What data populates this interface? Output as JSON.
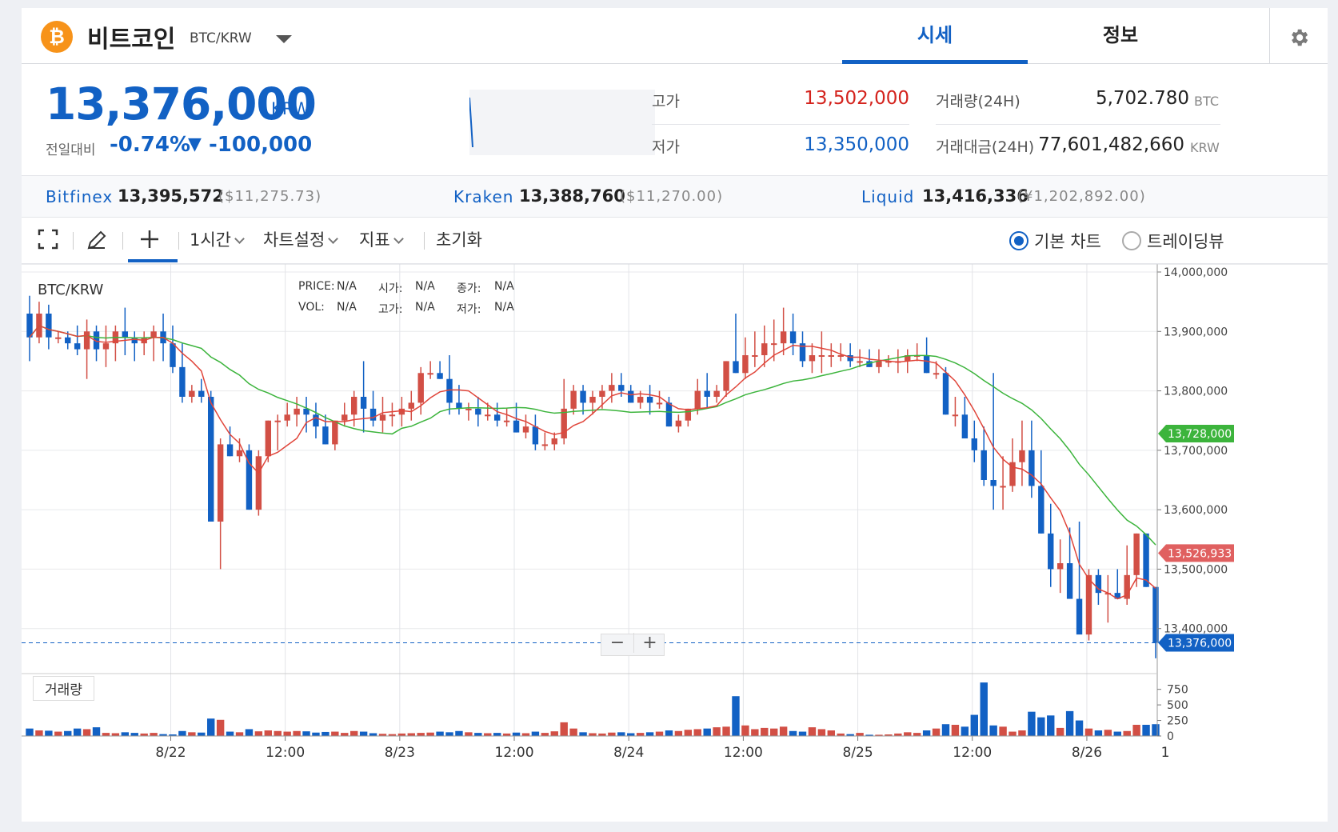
{
  "header": {
    "coin_symbol": "₿",
    "coin_name": "비트코인",
    "pair": "BTC/KRW",
    "tabs": [
      {
        "label": "시세",
        "active": true
      },
      {
        "label": "정보",
        "active": false
      }
    ]
  },
  "summary": {
    "price": "13,376,000",
    "unit": "KRW",
    "change_label": "전일대비",
    "change_rate": "-0.74%",
    "change_arrow": "▼",
    "change_amount": "-100,000",
    "high_label": "고가",
    "high_value": "13,502,000",
    "low_label": "저가",
    "low_value": "13,350,000",
    "volume_label": "거래량(24H)",
    "volume_value": "5,702.780",
    "volume_unit": "BTC",
    "amount_label": "거래대금(24H)",
    "amount_value": "77,601,482,660",
    "amount_unit": "KRW"
  },
  "exchanges": [
    {
      "name": "Bitfinex",
      "price": "13,395,572",
      "alt": "($11,275.73)"
    },
    {
      "name": "Kraken",
      "price": "13,388,760",
      "alt": "($11,270.00)"
    },
    {
      "name": "Liquid",
      "price": "13,416,336",
      "alt": "(¥1,202,892.00)"
    }
  ],
  "toolbar": {
    "interval": "1시간",
    "chart_settings": "차트설정",
    "indicators": "지표",
    "reset": "초기화",
    "basic_chart": "기본 차트",
    "tradingview": "트레이딩뷰"
  },
  "chart_overlay": {
    "symbol": "BTC/KRW",
    "price_label": "PRICE:",
    "price_val": "N/A",
    "open_label": "시가:",
    "open_val": "N/A",
    "close_label": "종가:",
    "close_val": "N/A",
    "vol_label": "VOL:",
    "vol_val": "N/A",
    "high_label": "고가:",
    "high_val": "N/A",
    "low_label": "저가:",
    "low_val": "N/A",
    "volume_pane_label": "거래량",
    "zoom_out": "−",
    "zoom_in": "+"
  },
  "colors": {
    "up": "#d24f45",
    "down": "#1261c4",
    "ma_short": "#e0453a",
    "ma_long": "#3cb43c",
    "accent": "#1261c4",
    "ma_long_tag": "#3cb43c",
    "ma_short_tag": "#e06060"
  },
  "chart_data": {
    "type": "candlestick",
    "series": "BTC/KRW",
    "interval": "1시간",
    "y_ticks": [
      14000000,
      13900000,
      13800000,
      13700000,
      13600000,
      13500000,
      13400000
    ],
    "y_tick_labels": [
      "14,000,000",
      "13,900,000",
      "13,800,000",
      "13,700,000",
      "13,600,000",
      "13,500,000",
      "13,400,000"
    ],
    "ylim": [
      13370000,
      14000000
    ],
    "x_labels": [
      "8/22",
      "12:00",
      "8/23",
      "12:00",
      "8/24",
      "12:00",
      "8/25",
      "12:00",
      "8/26",
      "1"
    ],
    "x_label_index": [
      8,
      20,
      32,
      44,
      56,
      68,
      80,
      92,
      104,
      115
    ],
    "price_tags": [
      {
        "label": "13,728,000",
        "value": 13728000,
        "kind": "ma_long"
      },
      {
        "label": "13,526,933",
        "value": 13526933,
        "kind": "ma_short"
      },
      {
        "label": "13,376,000",
        "value": 13376000,
        "kind": "current"
      }
    ],
    "volume_ticks": [
      750,
      500,
      250,
      0
    ],
    "volume_tick_labels": [
      "750",
      "500",
      "250",
      "0"
    ],
    "ylim_volume": [
      0,
      900
    ],
    "candles": [
      [
        13930000,
        13960000,
        13850000,
        13890000,
        120
      ],
      [
        13890000,
        13950000,
        13880000,
        13930000,
        90
      ],
      [
        13930000,
        13945000,
        13870000,
        13890000,
        85
      ],
      [
        13890000,
        13900000,
        13880000,
        13890000,
        70
      ],
      [
        13890000,
        13900000,
        13870000,
        13880000,
        80
      ],
      [
        13880000,
        13910000,
        13860000,
        13870000,
        120
      ],
      [
        13870000,
        13920000,
        13820000,
        13900000,
        110
      ],
      [
        13900000,
        13910000,
        13850000,
        13870000,
        140
      ],
      [
        13870000,
        13910000,
        13840000,
        13880000,
        50
      ],
      [
        13880000,
        13910000,
        13850000,
        13900000,
        45
      ],
      [
        13900000,
        13940000,
        13860000,
        13890000,
        60
      ],
      [
        13890000,
        13900000,
        13850000,
        13880000,
        50
      ],
      [
        13880000,
        13900000,
        13860000,
        13890000,
        40
      ],
      [
        13890000,
        13910000,
        13850000,
        13900000,
        50
      ],
      [
        13900000,
        13930000,
        13850000,
        13880000,
        30
      ],
      [
        13880000,
        13910000,
        13830000,
        13840000,
        25
      ],
      [
        13840000,
        13880000,
        13780000,
        13790000,
        80
      ],
      [
        13790000,
        13810000,
        13780000,
        13800000,
        60
      ],
      [
        13800000,
        13820000,
        13780000,
        13790000,
        55
      ],
      [
        13790000,
        13800000,
        13580000,
        13580000,
        280
      ],
      [
        13580000,
        13720000,
        13500000,
        13710000,
        260
      ],
      [
        13710000,
        13740000,
        13690000,
        13690000,
        70
      ],
      [
        13690000,
        13720000,
        13680000,
        13700000,
        60
      ],
      [
        13700000,
        13710000,
        13600000,
        13600000,
        110
      ],
      [
        13600000,
        13700000,
        13590000,
        13690000,
        75
      ],
      [
        13690000,
        13750000,
        13680000,
        13750000,
        90
      ],
      [
        13750000,
        13760000,
        13700000,
        13750000,
        80
      ],
      [
        13750000,
        13780000,
        13740000,
        13760000,
        70
      ],
      [
        13760000,
        13790000,
        13740000,
        13770000,
        80
      ],
      [
        13770000,
        13790000,
        13730000,
        13760000,
        75
      ],
      [
        13760000,
        13780000,
        13720000,
        13740000,
        55
      ],
      [
        13740000,
        13760000,
        13710000,
        13710000,
        65
      ],
      [
        13710000,
        13750000,
        13700000,
        13750000,
        70
      ],
      [
        13750000,
        13780000,
        13740000,
        13760000,
        50
      ],
      [
        13760000,
        13800000,
        13740000,
        13790000,
        80
      ],
      [
        13790000,
        13850000,
        13730000,
        13770000,
        70
      ],
      [
        13770000,
        13800000,
        13740000,
        13750000,
        45
      ],
      [
        13750000,
        13790000,
        13730000,
        13760000,
        35
      ],
      [
        13760000,
        13780000,
        13740000,
        13760000,
        30
      ],
      [
        13760000,
        13790000,
        13740000,
        13770000,
        40
      ],
      [
        13770000,
        13800000,
        13750000,
        13780000,
        45
      ],
      [
        13780000,
        13840000,
        13760000,
        13830000,
        50
      ],
      [
        13830000,
        13850000,
        13820000,
        13830000,
        55
      ],
      [
        13830000,
        13850000,
        13820000,
        13820000,
        70
      ],
      [
        13820000,
        13860000,
        13760000,
        13780000,
        60
      ],
      [
        13780000,
        13810000,
        13760000,
        13770000,
        80
      ],
      [
        13770000,
        13780000,
        13750000,
        13770000,
        60
      ],
      [
        13770000,
        13790000,
        13740000,
        13760000,
        50
      ],
      [
        13760000,
        13780000,
        13750000,
        13760000,
        45
      ],
      [
        13760000,
        13780000,
        13740000,
        13750000,
        50
      ],
      [
        13750000,
        13770000,
        13740000,
        13750000,
        40
      ],
      [
        13750000,
        13780000,
        13730000,
        13730000,
        55
      ],
      [
        13730000,
        13760000,
        13720000,
        13740000,
        45
      ],
      [
        13740000,
        13760000,
        13700000,
        13710000,
        70
      ],
      [
        13710000,
        13730000,
        13700000,
        13710000,
        50
      ],
      [
        13710000,
        13730000,
        13700000,
        13720000,
        75
      ],
      [
        13720000,
        13820000,
        13710000,
        13770000,
        220
      ],
      [
        13770000,
        13810000,
        13760000,
        13800000,
        120
      ],
      [
        13800000,
        13810000,
        13760000,
        13780000,
        60
      ],
      [
        13780000,
        13800000,
        13760000,
        13790000,
        45
      ],
      [
        13790000,
        13810000,
        13770000,
        13800000,
        40
      ],
      [
        13800000,
        13830000,
        13780000,
        13810000,
        55
      ],
      [
        13810000,
        13830000,
        13790000,
        13800000,
        60
      ],
      [
        13800000,
        13810000,
        13780000,
        13780000,
        45
      ],
      [
        13780000,
        13800000,
        13770000,
        13790000,
        50
      ],
      [
        13790000,
        13810000,
        13760000,
        13780000,
        60
      ],
      [
        13780000,
        13800000,
        13770000,
        13780000,
        70
      ],
      [
        13780000,
        13790000,
        13740000,
        13740000,
        90
      ],
      [
        13740000,
        13760000,
        13730000,
        13750000,
        80
      ],
      [
        13750000,
        13770000,
        13740000,
        13770000,
        100
      ],
      [
        13770000,
        13820000,
        13760000,
        13800000,
        110
      ],
      [
        13800000,
        13830000,
        13770000,
        13790000,
        120
      ],
      [
        13790000,
        13810000,
        13780000,
        13800000,
        140
      ],
      [
        13800000,
        13850000,
        13790000,
        13850000,
        150
      ],
      [
        13850000,
        13930000,
        13830000,
        13830000,
        640
      ],
      [
        13830000,
        13890000,
        13820000,
        13860000,
        170
      ],
      [
        13860000,
        13900000,
        13840000,
        13860000,
        110
      ],
      [
        13860000,
        13910000,
        13840000,
        13880000,
        130
      ],
      [
        13880000,
        13920000,
        13850000,
        13880000,
        120
      ],
      [
        13880000,
        13940000,
        13860000,
        13900000,
        150
      ],
      [
        13900000,
        13930000,
        13860000,
        13880000,
        80
      ],
      [
        13880000,
        13900000,
        13840000,
        13850000,
        70
      ],
      [
        13850000,
        13880000,
        13830000,
        13860000,
        140
      ],
      [
        13860000,
        13900000,
        13830000,
        13860000,
        110
      ],
      [
        13860000,
        13880000,
        13840000,
        13860000,
        90
      ],
      [
        13860000,
        13880000,
        13850000,
        13860000,
        40
      ],
      [
        13860000,
        13880000,
        13840000,
        13850000,
        30
      ],
      [
        13850000,
        13870000,
        13840000,
        13850000,
        50
      ],
      [
        13850000,
        13870000,
        13840000,
        13840000,
        20
      ],
      [
        13840000,
        13870000,
        13830000,
        13850000,
        20
      ],
      [
        13850000,
        13860000,
        13840000,
        13850000,
        25
      ],
      [
        13850000,
        13870000,
        13830000,
        13850000,
        40
      ],
      [
        13850000,
        13870000,
        13830000,
        13860000,
        60
      ],
      [
        13860000,
        13880000,
        13850000,
        13860000,
        50
      ],
      [
        13860000,
        13890000,
        13830000,
        13830000,
        90
      ],
      [
        13830000,
        13850000,
        13820000,
        13830000,
        120
      ],
      [
        13830000,
        13840000,
        13760000,
        13760000,
        190
      ],
      [
        13760000,
        13790000,
        13740000,
        13760000,
        180
      ],
      [
        13760000,
        13790000,
        13730000,
        13720000,
        150
      ],
      [
        13720000,
        13750000,
        13680000,
        13700000,
        340
      ],
      [
        13700000,
        13740000,
        13640000,
        13650000,
        860
      ],
      [
        13650000,
        13830000,
        13600000,
        13640000,
        170
      ],
      [
        13640000,
        13690000,
        13600000,
        13640000,
        150
      ],
      [
        13640000,
        13720000,
        13630000,
        13680000,
        70
      ],
      [
        13680000,
        13750000,
        13640000,
        13700000,
        90
      ],
      [
        13700000,
        13750000,
        13620000,
        13640000,
        390
      ],
      [
        13640000,
        13700000,
        13560000,
        13560000,
        300
      ],
      [
        13560000,
        13610000,
        13470000,
        13500000,
        330
      ],
      [
        13500000,
        13550000,
        13460000,
        13510000,
        130
      ],
      [
        13510000,
        13570000,
        13460000,
        13450000,
        400
      ],
      [
        13450000,
        13580000,
        13440000,
        13390000,
        250
      ],
      [
        13390000,
        13500000,
        13380000,
        13490000,
        120
      ],
      [
        13490000,
        13500000,
        13440000,
        13460000,
        90
      ],
      [
        13460000,
        13490000,
        13410000,
        13460000,
        100
      ],
      [
        13460000,
        13500000,
        13450000,
        13450000,
        70
      ],
      [
        13450000,
        13540000,
        13440000,
        13490000,
        80
      ],
      [
        13490000,
        13560000,
        13470000,
        13560000,
        180
      ],
      [
        13560000,
        13560000,
        13470000,
        13470000,
        180
      ],
      [
        13470000,
        13470000,
        13350000,
        13376000,
        190
      ]
    ]
  }
}
